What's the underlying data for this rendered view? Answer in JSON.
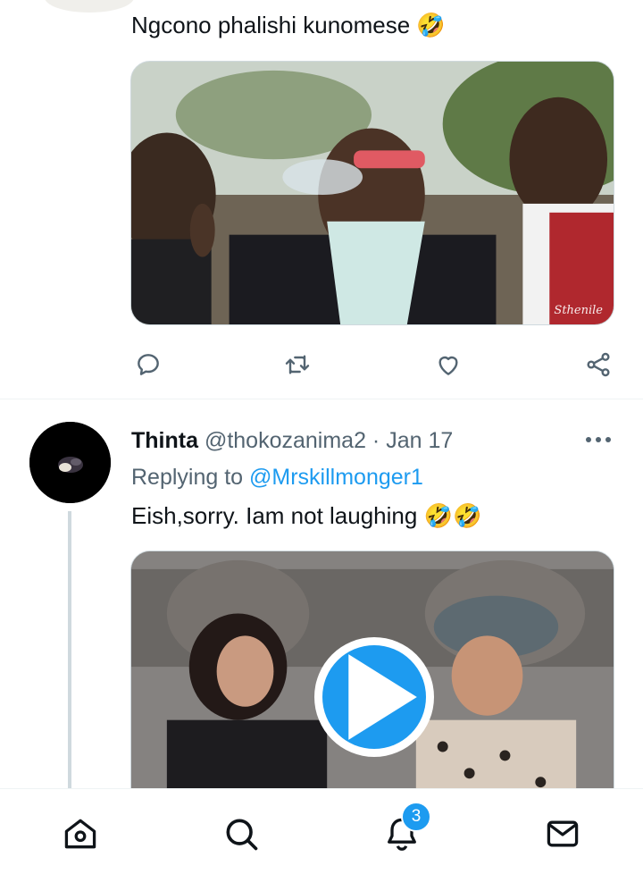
{
  "tweet1": {
    "text": "Ngcono phalishi kunomese 🤣",
    "media": {
      "watermark": "Sthenile"
    },
    "actions": [
      "reply-icon",
      "retweet-icon",
      "like-icon",
      "share-icon"
    ]
  },
  "tweet2": {
    "name": "Thinta",
    "handle": "@thokozanima2",
    "separator": " · ",
    "date": "Jan 17",
    "replying_prefix": "Replying to ",
    "replying_to": "@Mrskillmonger1",
    "text": "Eish,sorry. Iam not laughing ",
    "emojis": "🤣🤣",
    "media": {
      "type": "video",
      "icon": "play-icon"
    }
  },
  "bottom_nav": {
    "items": [
      "home-icon",
      "search-icon",
      "notifications-icon",
      "messages-icon"
    ],
    "notification_count": "3"
  },
  "colors": {
    "accent": "#1d9bf0",
    "text": "#0f1419",
    "secondary": "#536471",
    "border": "#cfd9de"
  }
}
